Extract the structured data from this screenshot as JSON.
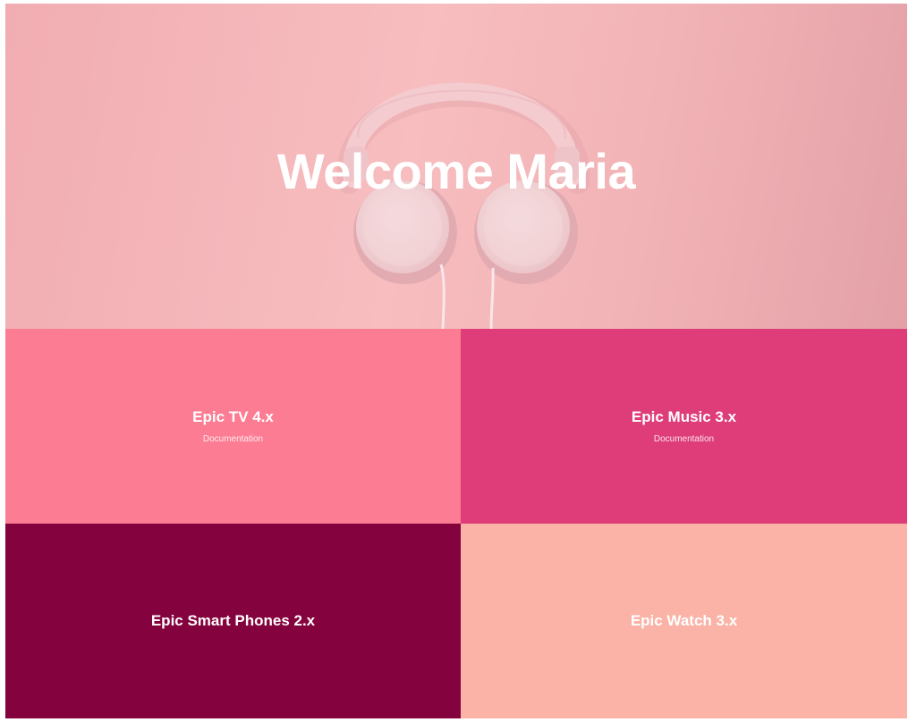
{
  "hero": {
    "title": "Welcome Maria",
    "image": "pink-headphones-photo"
  },
  "tiles": [
    {
      "title": "Epic TV 4.x",
      "subtitle": "Documentation",
      "color": "#fc7c93"
    },
    {
      "title": "Epic Music 3.x",
      "subtitle": "Documentation",
      "color": "#de3d79"
    },
    {
      "title": "Epic Smart Phones 2.x",
      "subtitle": "",
      "color": "#84023d"
    },
    {
      "title": "Epic Watch 3.x",
      "subtitle": "",
      "color": "#fab3a6"
    }
  ]
}
